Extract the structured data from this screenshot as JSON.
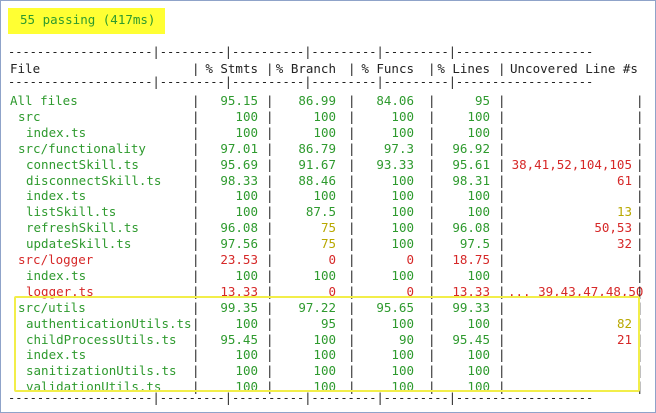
{
  "summary": {
    "passing": "55 passing (417ms)"
  },
  "dashes": {
    "top": "--------------------|---------|----------|---------|---------|-------------------",
    "sep": "--------------------|---------|----------|---------|---------|-------------------",
    "bot": "--------------------|---------|----------|---------|---------|-------------------"
  },
  "header": {
    "file": "File",
    "stmts": "% Stmts",
    "branch": "% Branch",
    "funcs": "% Funcs",
    "lines": "% Lines",
    "uncovered": "Uncovered Line #s"
  },
  "colors": {
    "green": "#2e9a2e",
    "red": "#d62828",
    "yellow": "#b8a800",
    "highlight": "#ffff33"
  },
  "rows": [
    {
      "file": "All files",
      "indent": 0,
      "stmts": "95.15",
      "branch": "86.99",
      "funcs": "84.06",
      "lines": "95",
      "uncovered": "",
      "color": "green",
      "cs": "green",
      "cb": "green",
      "cf": "green",
      "cl": "green",
      "cu": "green"
    },
    {
      "file": "src",
      "indent": 1,
      "stmts": "100",
      "branch": "100",
      "funcs": "100",
      "lines": "100",
      "uncovered": "",
      "color": "green",
      "cs": "green",
      "cb": "green",
      "cf": "green",
      "cl": "green",
      "cu": "green"
    },
    {
      "file": "index.ts",
      "indent": 2,
      "stmts": "100",
      "branch": "100",
      "funcs": "100",
      "lines": "100",
      "uncovered": "",
      "color": "green",
      "cs": "green",
      "cb": "green",
      "cf": "green",
      "cl": "green",
      "cu": "green"
    },
    {
      "file": "src/functionality",
      "indent": 1,
      "stmts": "97.01",
      "branch": "86.79",
      "funcs": "97.3",
      "lines": "96.92",
      "uncovered": "",
      "color": "green",
      "cs": "green",
      "cb": "green",
      "cf": "green",
      "cl": "green",
      "cu": "green"
    },
    {
      "file": "connectSkill.ts",
      "indent": 2,
      "stmts": "95.69",
      "branch": "91.67",
      "funcs": "93.33",
      "lines": "95.61",
      "uncovered": "38,41,52,104,105",
      "color": "green",
      "cs": "green",
      "cb": "green",
      "cf": "green",
      "cl": "green",
      "cu": "red"
    },
    {
      "file": "disconnectSkill.ts",
      "indent": 2,
      "stmts": "98.33",
      "branch": "88.46",
      "funcs": "100",
      "lines": "98.31",
      "uncovered": "61",
      "color": "green",
      "cs": "green",
      "cb": "green",
      "cf": "green",
      "cl": "green",
      "cu": "red"
    },
    {
      "file": "index.ts",
      "indent": 2,
      "stmts": "100",
      "branch": "100",
      "funcs": "100",
      "lines": "100",
      "uncovered": "",
      "color": "green",
      "cs": "green",
      "cb": "green",
      "cf": "green",
      "cl": "green",
      "cu": "green"
    },
    {
      "file": "listSkill.ts",
      "indent": 2,
      "stmts": "100",
      "branch": "87.5",
      "funcs": "100",
      "lines": "100",
      "uncovered": "13",
      "color": "green",
      "cs": "green",
      "cb": "green",
      "cf": "green",
      "cl": "green",
      "cu": "yellow"
    },
    {
      "file": "refreshSkill.ts",
      "indent": 2,
      "stmts": "96.08",
      "branch": "75",
      "funcs": "100",
      "lines": "96.08",
      "uncovered": "50,53",
      "color": "green",
      "cs": "green",
      "cb": "yellow",
      "cf": "green",
      "cl": "green",
      "cu": "red"
    },
    {
      "file": "updateSkill.ts",
      "indent": 2,
      "stmts": "97.56",
      "branch": "75",
      "funcs": "100",
      "lines": "97.5",
      "uncovered": "32",
      "color": "green",
      "cs": "green",
      "cb": "yellow",
      "cf": "green",
      "cl": "green",
      "cu": "red"
    },
    {
      "file": "src/logger",
      "indent": 1,
      "stmts": "23.53",
      "branch": "0",
      "funcs": "0",
      "lines": "18.75",
      "uncovered": "",
      "color": "red",
      "cs": "red",
      "cb": "red",
      "cf": "red",
      "cl": "red",
      "cu": "red"
    },
    {
      "file": "index.ts",
      "indent": 2,
      "stmts": "100",
      "branch": "100",
      "funcs": "100",
      "lines": "100",
      "uncovered": "",
      "color": "green",
      "cs": "green",
      "cb": "green",
      "cf": "green",
      "cl": "green",
      "cu": "green"
    },
    {
      "file": "logger.ts",
      "indent": 2,
      "stmts": "13.33",
      "branch": "0",
      "funcs": "0",
      "lines": "13.33",
      "uncovered": "... 39,43,47,48,50",
      "color": "red",
      "cs": "red",
      "cb": "red",
      "cf": "red",
      "cl": "red",
      "cu": "red"
    },
    {
      "file": "src/utils",
      "indent": 1,
      "stmts": "99.35",
      "branch": "97.22",
      "funcs": "95.65",
      "lines": "99.33",
      "uncovered": "",
      "color": "green",
      "cs": "green",
      "cb": "green",
      "cf": "green",
      "cl": "green",
      "cu": "green"
    },
    {
      "file": "authenticationUtils.ts",
      "indent": 2,
      "stmts": "100",
      "branch": "95",
      "funcs": "100",
      "lines": "100",
      "uncovered": "82",
      "color": "green",
      "cs": "green",
      "cb": "green",
      "cf": "green",
      "cl": "green",
      "cu": "yellow"
    },
    {
      "file": "childProcessUtils.ts",
      "indent": 2,
      "stmts": "95.45",
      "branch": "100",
      "funcs": "90",
      "lines": "95.45",
      "uncovered": "21",
      "color": "green",
      "cs": "green",
      "cb": "green",
      "cf": "green",
      "cl": "green",
      "cu": "red"
    },
    {
      "file": "index.ts",
      "indent": 2,
      "stmts": "100",
      "branch": "100",
      "funcs": "100",
      "lines": "100",
      "uncovered": "",
      "color": "green",
      "cs": "green",
      "cb": "green",
      "cf": "green",
      "cl": "green",
      "cu": "green"
    },
    {
      "file": "sanitizationUtils.ts",
      "indent": 2,
      "stmts": "100",
      "branch": "100",
      "funcs": "100",
      "lines": "100",
      "uncovered": "",
      "color": "green",
      "cs": "green",
      "cb": "green",
      "cf": "green",
      "cl": "green",
      "cu": "green"
    },
    {
      "file": "validationUtils.ts",
      "indent": 2,
      "stmts": "100",
      "branch": "100",
      "funcs": "100",
      "lines": "100",
      "uncovered": "",
      "color": "green",
      "cs": "green",
      "cb": "green",
      "cf": "green",
      "cl": "green",
      "cu": "green"
    }
  ]
}
